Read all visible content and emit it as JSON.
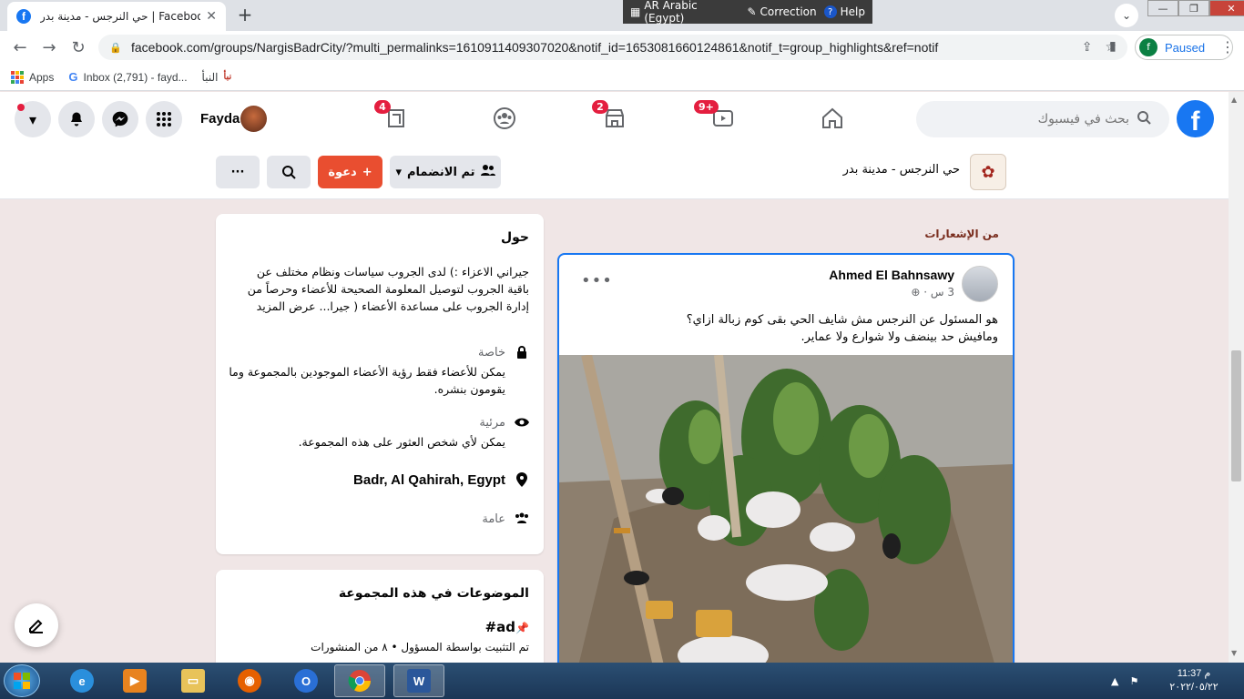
{
  "browser": {
    "tab_title": "حي النرجس - مدينة بدر | Facebook",
    "tab_close": "✕",
    "new_tab": "+",
    "ime": {
      "language": "AR Arabic (Egypt)",
      "correction": "Correction",
      "help": "Help"
    },
    "url": "facebook.com/groups/NargisBadrCity/?multi_permalinks=1610911409307020&notif_id=1653081660124861&notif_t=group_highlights&ref=notif",
    "profile_initial": "f",
    "profile_status": "Paused",
    "bookmarks": [
      {
        "label": "Apps",
        "icon": "apps-grid-icon"
      },
      {
        "label": "Inbox (2,791) - fayd...",
        "icon": "google-icon"
      },
      {
        "label": "النبأ",
        "icon": "nabaa-icon"
      }
    ]
  },
  "fb_header": {
    "user_name": "Fayda",
    "search_placeholder": "بحث في فيسبوك",
    "logo_letter": "f",
    "nav_badges": {
      "pages": "4",
      "marketplace": "2",
      "watch": "9+"
    }
  },
  "group": {
    "title": "حي النرجس - مدينة بدر",
    "joined_label": "تم الانضمام",
    "invite_label": "دعوة",
    "more_label": "···"
  },
  "about": {
    "title": "حول",
    "description": "جيراني الاعزاء :) لدى الجروب سياسات ونظام مختلف عن باقية الجروب لتوصيل المعلومة الصحيحة للأعضاء وحرصاً من إدارة الجروب على مساعدة الأعضاء ( جيرا... عرض المزيد",
    "privacy_title": "خاصة",
    "privacy_text": "يمكن للأعضاء فقط رؤية الأعضاء الموجودين بالمجموعة وما يقومون بنشره.",
    "visibility_title": "مرئية",
    "visibility_text": "يمكن لأي شخص العثور على هذه المجموعة.",
    "location": "Badr, Al Qahirah, Egypt",
    "type": "عامة"
  },
  "topics": {
    "title": "الموضوعات في هذه المجموعة",
    "tag": "#ad",
    "meta": "تم التثبيت بواسطة المسؤول • ٨ من المنشورات"
  },
  "post": {
    "section_label": "من الإشعارات",
    "author": "Ahmed El Bahnsawy",
    "time": "3 س ·",
    "more": "•••",
    "text_line1": "هو المسئول عن النرجس مش شايف الحي بقى كوم زبالة ازاي؟",
    "text_line2": "ومافيش حد بينضف ولا شوارع ولا عماير."
  },
  "taskbar": {
    "clock_time": "11:37 م",
    "clock_date": "٢٠٢٢/٠٥/٢٢",
    "apps": [
      "ie-icon",
      "media-player-icon",
      "file-explorer-icon",
      "firefox-icon",
      "opera-icon",
      "chrome-icon",
      "word-icon"
    ]
  },
  "colors": {
    "facebook_blue": "#1877f2",
    "invite_red": "#e94e30",
    "badge_red": "#e41e3f",
    "page_bg": "#f0e6e6"
  }
}
